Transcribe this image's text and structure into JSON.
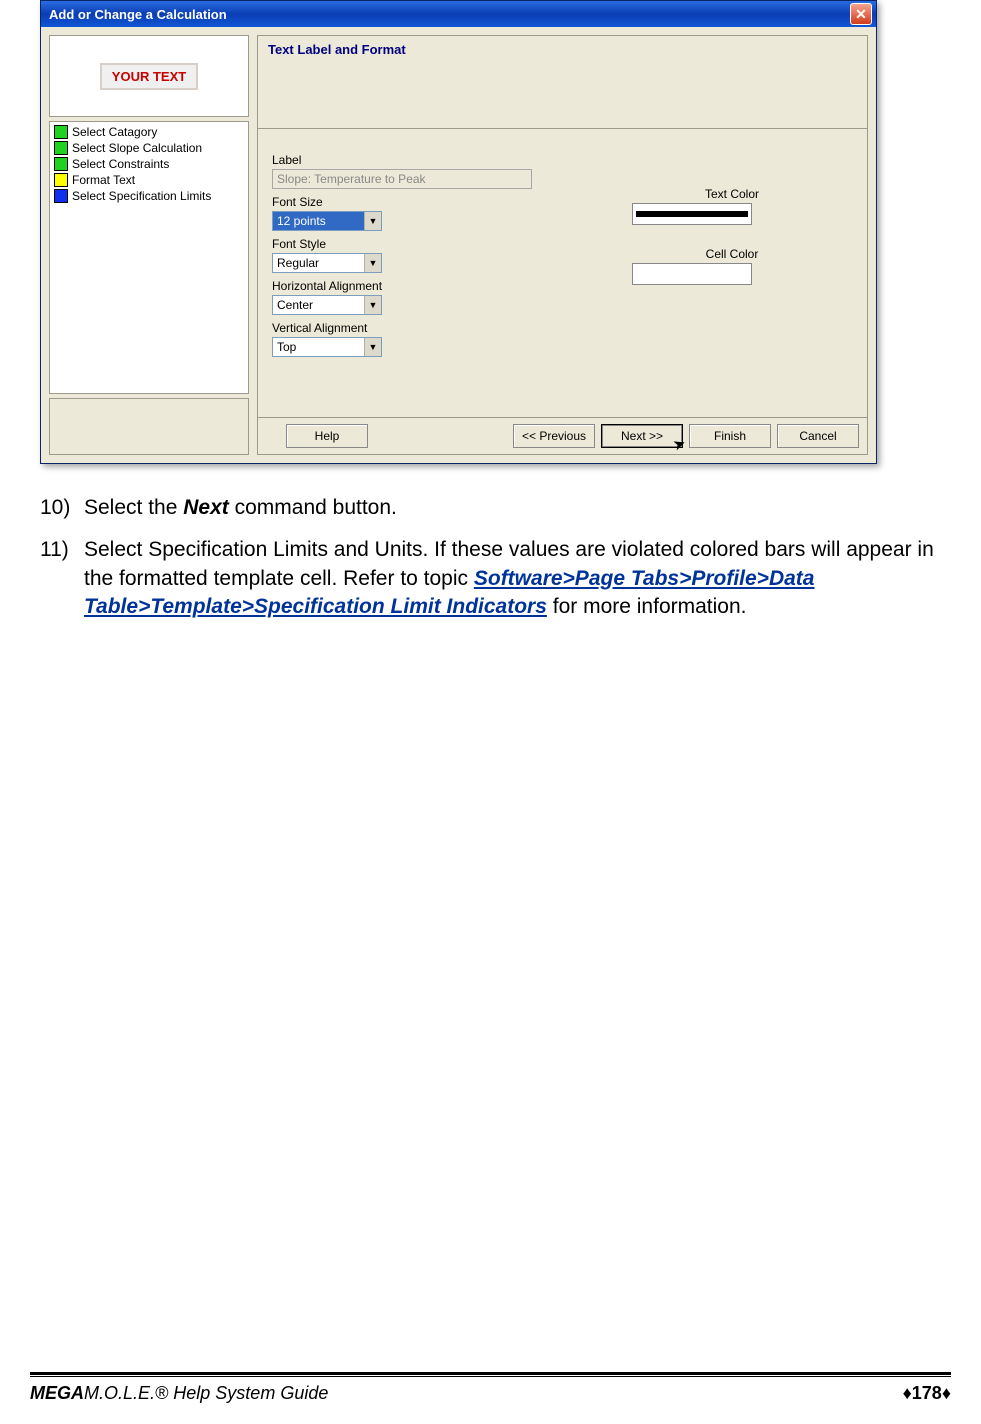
{
  "window": {
    "title": "Add or Change a Calculation",
    "preview_text": "YOUR TEXT",
    "steps": [
      {
        "label": "Select Catagory",
        "color": "green"
      },
      {
        "label": "Select Slope Calculation",
        "color": "green"
      },
      {
        "label": "Select Constraints",
        "color": "green"
      },
      {
        "label": "Format Text",
        "color": "yellow"
      },
      {
        "label": "Select Specification Limits",
        "color": "blue"
      }
    ],
    "section_title": "Text Label and Format",
    "form": {
      "label_lbl": "Label",
      "label_value": "Slope: Temperature to Peak",
      "fontsize_lbl": "Font Size",
      "fontsize_value": "12 points",
      "fontstyle_lbl": "Font Style",
      "fontstyle_value": "Regular",
      "halign_lbl": "Horizontal Alignment",
      "halign_value": "Center",
      "valign_lbl": "Vertical Alignment",
      "valign_value": "Top",
      "textcolor_lbl": "Text Color",
      "cellcolor_lbl": "Cell Color"
    },
    "buttons": {
      "help": "Help",
      "prev": "<< Previous",
      "next": "Next >>",
      "finish": "Finish",
      "cancel": "Cancel"
    }
  },
  "instructions": {
    "item10_num": "10)",
    "item10_a": "Select the ",
    "item10_b": "Next",
    "item10_c": " command button.",
    "item11_num": "11)",
    "item11_a": "Select Specification Limits and Units. If these values are violated colored bars will appear in the formatted template cell. Refer to  topic ",
    "item11_link": "Software>Page Tabs>Profile>Data Table>Template>Specification Limit Indicators",
    "item11_b": " for more information."
  },
  "footer": {
    "title_a": "MEGA",
    "title_b": "M.O.L.E.® Help System Guide",
    "page": "178"
  }
}
